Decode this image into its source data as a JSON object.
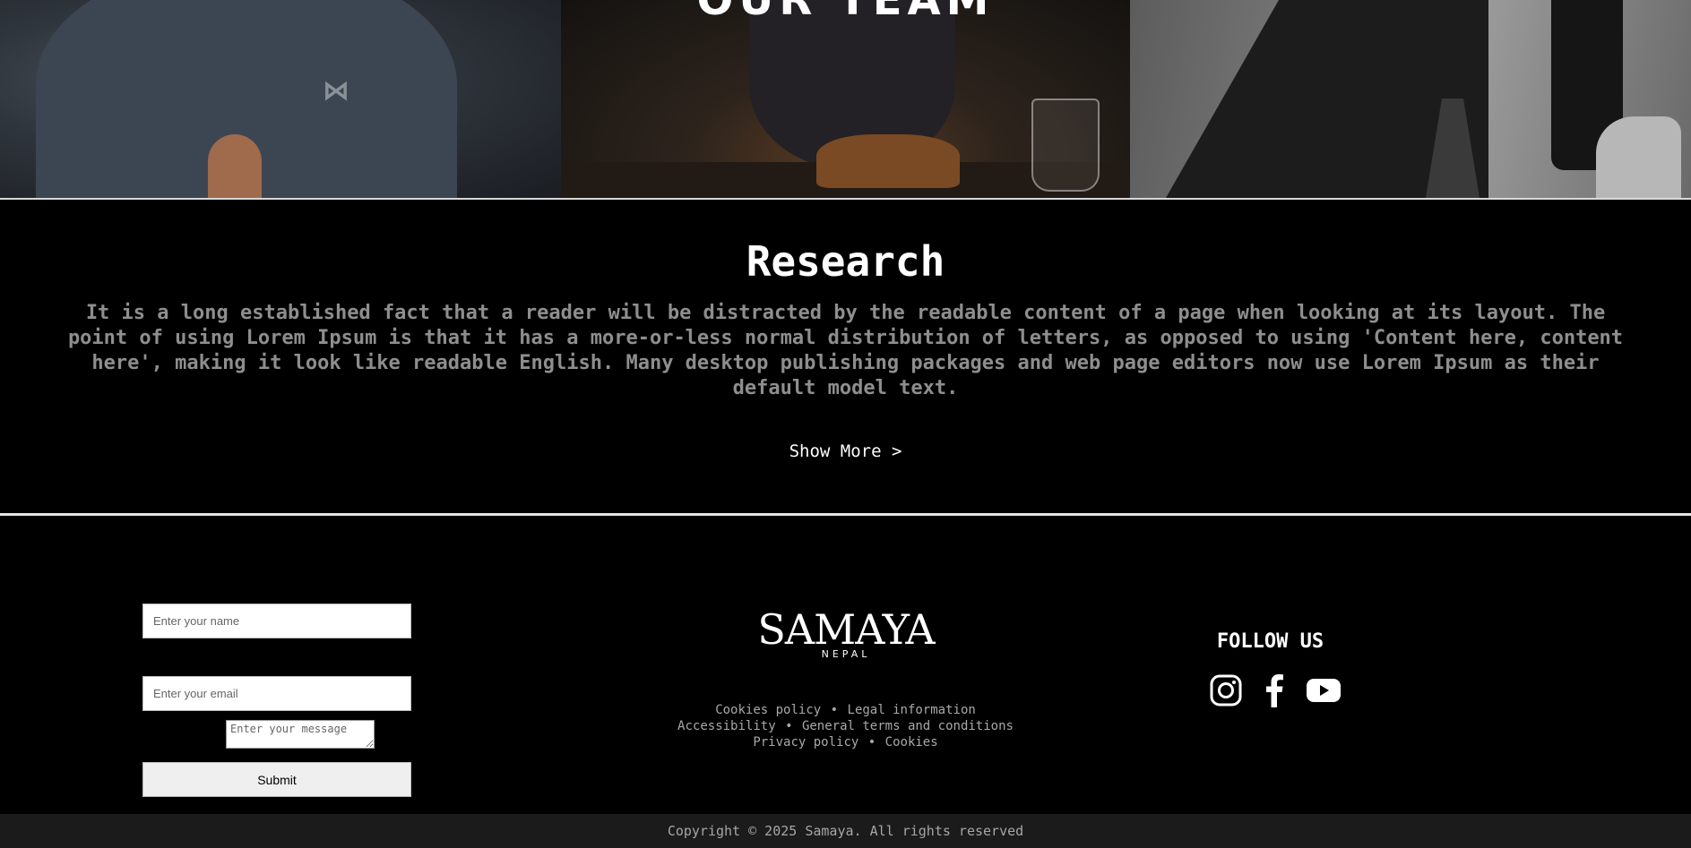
{
  "hero": {
    "title": "OUR TEAM"
  },
  "research": {
    "title": "Research",
    "body": "It is a long established fact that a reader will be distracted by the readable content of a page when looking at its layout. The point of using Lorem Ipsum is that it has a more-or-less normal distribution of letters, as opposed to using 'Content here, content here', making it look like readable English. Many desktop publishing packages and web page editors now use Lorem Ipsum as their default model text.",
    "show_more": "Show More >"
  },
  "contact_form": {
    "name_placeholder": "Enter your name",
    "email_placeholder": "Enter your email",
    "message_placeholder": "Enter your message",
    "submit_label": "Submit"
  },
  "brand": {
    "name": "SAMAYA",
    "sub": "NEPAL"
  },
  "footer_links": {
    "row1": [
      "Cookies policy",
      "Legal information"
    ],
    "row2": [
      "Accessibility",
      "General terms and conditions"
    ],
    "row3": [
      "Privacy policy",
      "Cookies"
    ],
    "separator": "•"
  },
  "social": {
    "heading": "FOLLOW US",
    "icons": [
      "instagram-icon",
      "facebook-icon",
      "youtube-icon"
    ]
  },
  "copyright": "Copyright © 2025 Samaya. All rights reserved",
  "colors": {
    "background": "#000000",
    "body_text": "#8e8e8e",
    "copyright_bar": "#1b1b1b"
  }
}
